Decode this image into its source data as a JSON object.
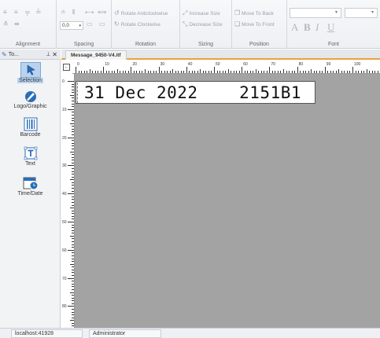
{
  "ribbon": {
    "alignment": {
      "label": "Alignment"
    },
    "spacing": {
      "label": "Spacing",
      "value": "0,0"
    },
    "rotation": {
      "label": "Rotation",
      "anticlockwise": "Rotate Anticlockwise",
      "clockwise": "Rotate Clockwise"
    },
    "sizing": {
      "label": "Sizing",
      "increase": "Increase Size",
      "decrease": "Decrease Size"
    },
    "position": {
      "label": "Position",
      "back": "Move To Back",
      "front": "Move To Front"
    },
    "font": {
      "label": "Font",
      "bold": "B",
      "italic": "I",
      "underline": "U",
      "a": "A"
    }
  },
  "toolbox": {
    "tab_title": "To...",
    "items": [
      {
        "label": "Selection",
        "icon": "selection-arrow-icon"
      },
      {
        "label": "Logo/Graphic",
        "icon": "logo-graphic-icon"
      },
      {
        "label": "Barcode",
        "icon": "barcode-icon"
      },
      {
        "label": "Text",
        "icon": "text-icon"
      },
      {
        "label": "Time/Date",
        "icon": "calendar-clock-icon"
      }
    ]
  },
  "document": {
    "tab": "Message_9450-V4.itf",
    "label_text": "31 Dec 2022    2151B1",
    "h_ruler": [
      "0",
      "10",
      "20",
      "30",
      "40",
      "50",
      "60",
      "70",
      "80",
      "90",
      "100"
    ],
    "v_ruler": [
      "0",
      "10",
      "20",
      "30",
      "40",
      "50",
      "60",
      "70",
      "80",
      "90"
    ]
  },
  "statusbar": {
    "host": "localhost:41928",
    "user": "Administrator"
  },
  "colors": {
    "accent": "#e8a33c",
    "canvas": "#a3a3a3",
    "selected_tool": "#b9d3ee"
  }
}
